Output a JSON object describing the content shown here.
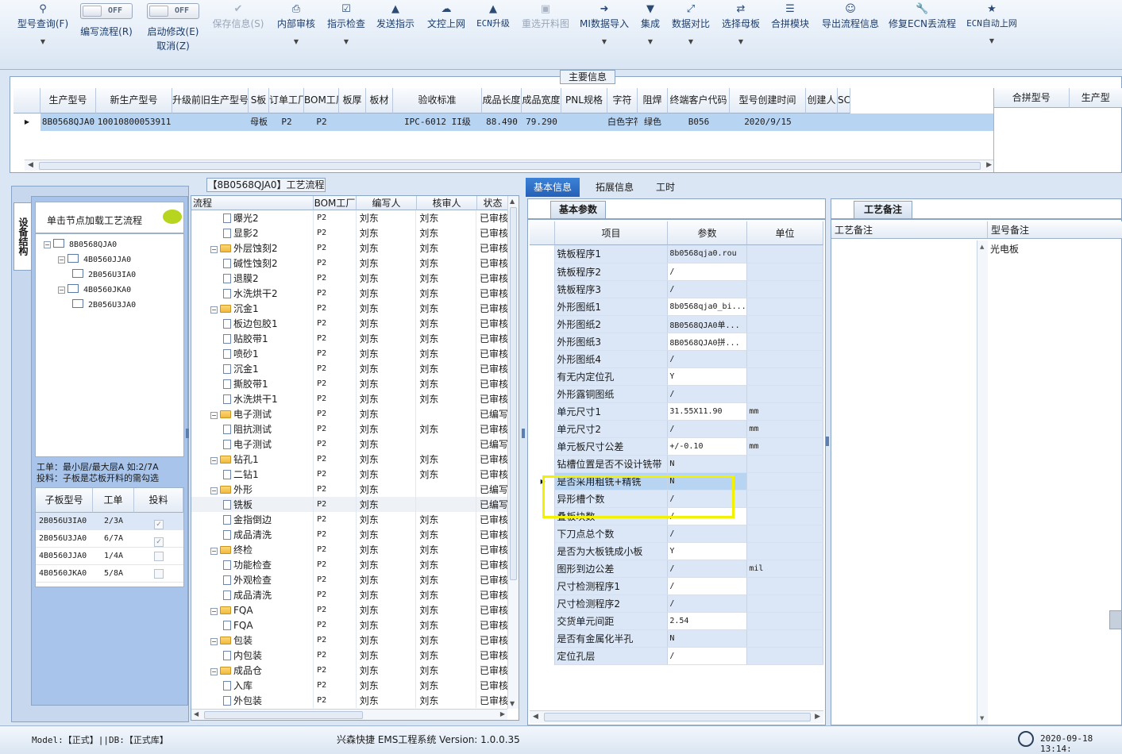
{
  "toolbar": {
    "items": [
      {
        "label": "型号查询(F)",
        "icon": "search-icon"
      },
      {
        "label": "编写流程(R)",
        "toggle": "OFF"
      },
      {
        "label": "启动修改(E)",
        "sub": "取消(Z)",
        "toggle": "OFF"
      },
      {
        "label": "保存信息(S)",
        "icon": "check-icon",
        "disabled": true
      },
      {
        "label": "内部审核",
        "icon": "printer-icon"
      },
      {
        "label": "指示检查",
        "icon": "checkbox-icon"
      },
      {
        "label": "发送指示",
        "icon": "upload-icon"
      },
      {
        "label": "文控上网",
        "icon": "cloud-icon"
      },
      {
        "label": "ECN升级",
        "icon": "upgrade-icon"
      },
      {
        "label": "重选开料图",
        "icon": "image-icon",
        "disabled": true
      },
      {
        "label": "MI数据导入",
        "icon": "import-icon"
      },
      {
        "label": "集成",
        "icon": "download-icon"
      },
      {
        "label": "数据对比",
        "icon": "compress-icon"
      },
      {
        "label": "选择母板",
        "icon": "shuffle-icon"
      },
      {
        "label": "合拼模块",
        "icon": "list-icon"
      },
      {
        "label": "导出流程信息",
        "icon": "smile-icon"
      },
      {
        "label": "修复ECN丢流程",
        "icon": "wrench-icon"
      },
      {
        "label": "ECN自动上网",
        "icon": "star-icon"
      }
    ]
  },
  "main_info": {
    "title": "主要信息",
    "columns": [
      "生产型号",
      "新生产型号",
      "升级前旧生产型号",
      "S板",
      "订单工厂",
      "BOM工厂",
      "板厚",
      "板材",
      "验收标准",
      "成品长度",
      "成品宽度",
      "PNL规格",
      "字符",
      "阻焊",
      "终端客户代码",
      "型号创建时间",
      "创建人",
      "SC"
    ],
    "row": [
      "8B0568QJA0",
      "10010800053911",
      "",
      "母板",
      "P2",
      "P2",
      "",
      "",
      "IPC-6012 II级",
      "88.490",
      "79.290",
      "",
      "白色字符",
      "绿色",
      "B056",
      "2020/9/15",
      "",
      ""
    ],
    "side_columns": [
      "合拼型号",
      "生产型"
    ]
  },
  "structure": {
    "vertical_tab": "设备结构",
    "hint": "单击节点加载工艺流程",
    "tree": [
      {
        "label": "8B0568QJA0",
        "level": 0
      },
      {
        "label": "4B0560JJA0",
        "level": 1
      },
      {
        "label": "2B056U3IA0",
        "level": 2
      },
      {
        "label": "4B0560JKA0",
        "level": 1
      },
      {
        "label": "2B056U3JA0",
        "level": 2
      }
    ],
    "note1": "工单：最小层/最大层A 如:2/7A",
    "note2": "投料：子板是芯板开料的需勾选",
    "sub_columns": [
      "子板型号",
      "工单",
      "投料"
    ],
    "sub_rows": [
      {
        "model": "2B056U3IA0",
        "order": "2/3A",
        "checked": true
      },
      {
        "model": "2B056U3JA0",
        "order": "6/7A",
        "checked": true
      },
      {
        "model": "4B0560JJA0",
        "order": "1/4A",
        "checked": false
      },
      {
        "model": "4B0560JKA0",
        "order": "5/8A",
        "checked": false
      }
    ]
  },
  "process": {
    "title": "【8B0568QJA0】工艺流程",
    "columns": [
      "流程",
      "BOM工厂",
      "编写人",
      "核审人",
      "状态"
    ],
    "rows": [
      {
        "name": "曝光2",
        "level": 2,
        "bom": "P2",
        "writer": "刘东",
        "reviewer": "刘东",
        "status": "已审核"
      },
      {
        "name": "显影2",
        "level": 2,
        "bom": "P2",
        "writer": "刘东",
        "reviewer": "刘东",
        "status": "已审核"
      },
      {
        "name": "外层蚀刻2",
        "level": 1,
        "bom": "P2",
        "writer": "刘东",
        "reviewer": "刘东",
        "status": "已审核"
      },
      {
        "name": "碱性蚀刻2",
        "level": 2,
        "bom": "P2",
        "writer": "刘东",
        "reviewer": "刘东",
        "status": "已审核"
      },
      {
        "name": "退膜2",
        "level": 2,
        "bom": "P2",
        "writer": "刘东",
        "reviewer": "刘东",
        "status": "已审核"
      },
      {
        "name": "水洗烘干2",
        "level": 2,
        "bom": "P2",
        "writer": "刘东",
        "reviewer": "刘东",
        "status": "已审核"
      },
      {
        "name": "沉金1",
        "level": 1,
        "bom": "P2",
        "writer": "刘东",
        "reviewer": "刘东",
        "status": "已审核"
      },
      {
        "name": "板边包胶1",
        "level": 2,
        "bom": "P2",
        "writer": "刘东",
        "reviewer": "刘东",
        "status": "已审核"
      },
      {
        "name": "贴胶带1",
        "level": 2,
        "bom": "P2",
        "writer": "刘东",
        "reviewer": "刘东",
        "status": "已审核"
      },
      {
        "name": "喷砂1",
        "level": 2,
        "bom": "P2",
        "writer": "刘东",
        "reviewer": "刘东",
        "status": "已审核"
      },
      {
        "name": "沉金1",
        "level": 2,
        "bom": "P2",
        "writer": "刘东",
        "reviewer": "刘东",
        "status": "已审核"
      },
      {
        "name": "撕胶带1",
        "level": 2,
        "bom": "P2",
        "writer": "刘东",
        "reviewer": "刘东",
        "status": "已审核"
      },
      {
        "name": "水洗烘干1",
        "level": 2,
        "bom": "P2",
        "writer": "刘东",
        "reviewer": "刘东",
        "status": "已审核"
      },
      {
        "name": "电子测试",
        "level": 1,
        "bom": "P2",
        "writer": "刘东",
        "reviewer": "",
        "status": "已编写"
      },
      {
        "name": "阻抗测试",
        "level": 2,
        "bom": "P2",
        "writer": "刘东",
        "reviewer": "刘东",
        "status": "已审核"
      },
      {
        "name": "电子测试",
        "level": 2,
        "bom": "P2",
        "writer": "刘东",
        "reviewer": "",
        "status": "已编写"
      },
      {
        "name": "钻孔1",
        "level": 1,
        "bom": "P2",
        "writer": "刘东",
        "reviewer": "刘东",
        "status": "已审核"
      },
      {
        "name": "二钻1",
        "level": 2,
        "bom": "P2",
        "writer": "刘东",
        "reviewer": "刘东",
        "status": "已审核"
      },
      {
        "name": "外形",
        "level": 1,
        "bom": "P2",
        "writer": "刘东",
        "reviewer": "",
        "status": "已编写"
      },
      {
        "name": "铣板",
        "level": 2,
        "bom": "P2",
        "writer": "刘东",
        "reviewer": "",
        "status": "已编写",
        "selected": true
      },
      {
        "name": "金指倒边",
        "level": 2,
        "bom": "P2",
        "writer": "刘东",
        "reviewer": "刘东",
        "status": "已审核"
      },
      {
        "name": "成品清洗",
        "level": 2,
        "bom": "P2",
        "writer": "刘东",
        "reviewer": "刘东",
        "status": "已审核"
      },
      {
        "name": "终检",
        "level": 1,
        "bom": "P2",
        "writer": "刘东",
        "reviewer": "刘东",
        "status": "已审核"
      },
      {
        "name": "功能检查",
        "level": 2,
        "bom": "P2",
        "writer": "刘东",
        "reviewer": "刘东",
        "status": "已审核"
      },
      {
        "name": "外观检查",
        "level": 2,
        "bom": "P2",
        "writer": "刘东",
        "reviewer": "刘东",
        "status": "已审核"
      },
      {
        "name": "成品清洗",
        "level": 2,
        "bom": "P2",
        "writer": "刘东",
        "reviewer": "刘东",
        "status": "已审核"
      },
      {
        "name": "FQA",
        "level": 1,
        "bom": "P2",
        "writer": "刘东",
        "reviewer": "刘东",
        "status": "已审核"
      },
      {
        "name": "FQA",
        "level": 2,
        "bom": "P2",
        "writer": "刘东",
        "reviewer": "刘东",
        "status": "已审核"
      },
      {
        "name": "包装",
        "level": 1,
        "bom": "P2",
        "writer": "刘东",
        "reviewer": "刘东",
        "status": "已审核"
      },
      {
        "name": "内包装",
        "level": 2,
        "bom": "P2",
        "writer": "刘东",
        "reviewer": "刘东",
        "status": "已审核"
      },
      {
        "name": "成品仓",
        "level": 1,
        "bom": "P2",
        "writer": "刘东",
        "reviewer": "刘东",
        "status": "已审核"
      },
      {
        "name": "入库",
        "level": 2,
        "bom": "P2",
        "writer": "刘东",
        "reviewer": "刘东",
        "status": "已审核"
      },
      {
        "name": "外包装",
        "level": 2,
        "bom": "P2",
        "writer": "刘东",
        "reviewer": "刘东",
        "status": "已审核"
      }
    ]
  },
  "detail": {
    "tabs": [
      "基本信息",
      "拓展信息",
      "工时"
    ],
    "subtab": "基本参数",
    "columns": [
      "项目",
      "参数",
      "单位"
    ],
    "rows": [
      {
        "item": "铣板程序1",
        "param": "8b0568qja0.rou",
        "unit": ""
      },
      {
        "item": "铣板程序2",
        "param": "/",
        "unit": ""
      },
      {
        "item": "铣板程序3",
        "param": "/",
        "unit": ""
      },
      {
        "item": "外形图纸1",
        "param": "8b0568qja0_bi...",
        "unit": ""
      },
      {
        "item": "外形图纸2",
        "param": "8B0568QJA0单...",
        "unit": ""
      },
      {
        "item": "外形图纸3",
        "param": "8B0568QJA0拼...",
        "unit": ""
      },
      {
        "item": "外形图纸4",
        "param": "/",
        "unit": ""
      },
      {
        "item": "有无内定位孔",
        "param": "Y",
        "unit": ""
      },
      {
        "item": "外形露铜图纸",
        "param": "/",
        "unit": ""
      },
      {
        "item": "单元尺寸1",
        "param": "31.55X11.90",
        "unit": "mm"
      },
      {
        "item": "单元尺寸2",
        "param": "/",
        "unit": "mm"
      },
      {
        "item": "单元板尺寸公差",
        "param": "+/-0.10",
        "unit": "mm"
      },
      {
        "item": "钻槽位置是否不设计铣带",
        "param": "N",
        "unit": ""
      },
      {
        "item": "是否采用粗铣+精铣",
        "param": "N",
        "unit": "",
        "selected": true
      },
      {
        "item": "异形槽个数",
        "param": "/",
        "unit": ""
      },
      {
        "item": "叠板块数",
        "param": "/",
        "unit": ""
      },
      {
        "item": "下刀点总个数",
        "param": "/",
        "unit": ""
      },
      {
        "item": "是否为大板铣成小板",
        "param": "Y",
        "unit": ""
      },
      {
        "item": "图形到边公差",
        "param": "/",
        "unit": "mil"
      },
      {
        "item": "尺寸检测程序1",
        "param": "/",
        "unit": ""
      },
      {
        "item": "尺寸检测程序2",
        "param": "/",
        "unit": ""
      },
      {
        "item": "交货单元间距",
        "param": "2.54",
        "unit": ""
      },
      {
        "item": "是否有金属化半孔",
        "param": "N",
        "unit": ""
      },
      {
        "item": "定位孔层",
        "param": "/",
        "unit": ""
      }
    ]
  },
  "remarks": {
    "tab": "工艺备注",
    "col1": "工艺备注",
    "col2": "型号备注",
    "model_remark": "光电板"
  },
  "statusbar": {
    "model": "Model:【正式】||DB:【正式库】",
    "system": "兴森快捷 EMS工程系统 Version: 1.0.0.35",
    "time": "2020-09-18 13:14:"
  },
  "colors": {
    "accent": "#2d6dc8",
    "highlight": "#f2f200",
    "selection": "#b8d4f3"
  }
}
